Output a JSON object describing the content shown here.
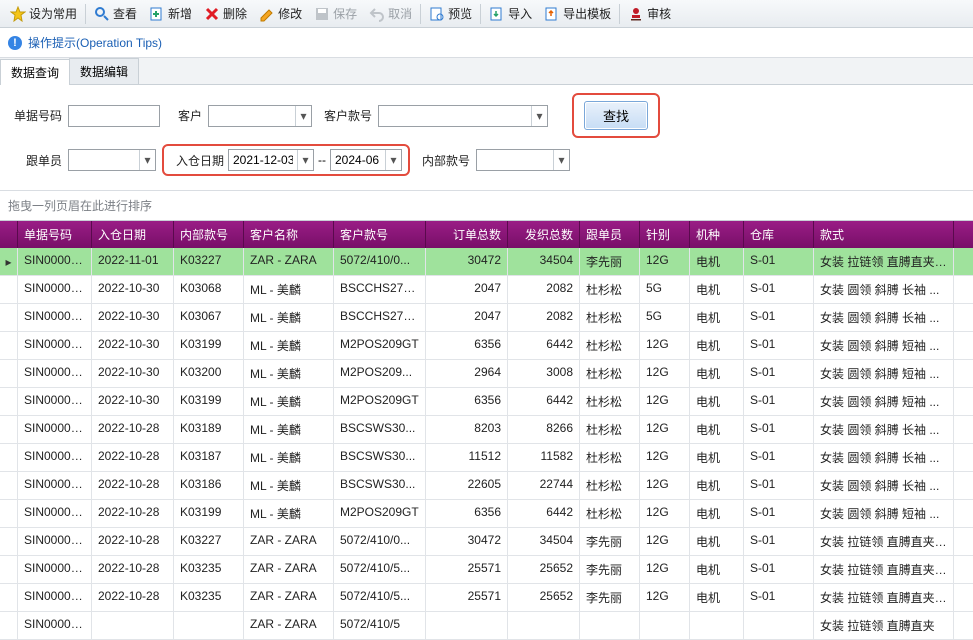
{
  "toolbar": {
    "fav": "设为常用",
    "view": "查看",
    "add": "新增",
    "del": "删除",
    "edit": "修改",
    "save": "保存",
    "cancel": "取消",
    "preview": "预览",
    "import": "导入",
    "exporttpl": "导出模板",
    "audit": "审核"
  },
  "tips": {
    "label": "操作提示(Operation Tips)"
  },
  "tabs": {
    "query": "数据查询",
    "edit": "数据编辑"
  },
  "search": {
    "doc_no_label": "单据号码",
    "cust_label": "客户",
    "cust_style_label": "客户款号",
    "follower_label": "跟单员",
    "indate_label": "入仓日期",
    "date_from": "2021-12-03",
    "date_to": "2024-06",
    "sep": "--",
    "internal_style_label": "内部款号",
    "btn": "查找"
  },
  "grid": {
    "group_hint": "拖曳一列页眉在此进行排序",
    "columns": [
      "单据号码",
      "入仓日期",
      "内部款号",
      "客户名称",
      "客户款号",
      "订单总数",
      "发织总数",
      "跟单员",
      "针别",
      "机种",
      "仓库",
      "款式"
    ],
    "rows": [
      {
        "sel": true,
        "d": [
          "SIN00006...",
          "2022-11-01",
          "K03227",
          "ZAR - ZARA",
          "5072/410/0...",
          "30472",
          "34504",
          "李先丽",
          "12G",
          "电机",
          "S-01",
          "女装 拉链领 直膊直夹 ..."
        ]
      },
      {
        "d": [
          "SIN00006...",
          "2022-10-30",
          "K03068",
          "ML - 美麟",
          "BSCCHS275...",
          "2047",
          "2082",
          "杜杉松",
          "5G",
          "电机",
          "S-01",
          "女装 圆领 斜膊 长袖 ..."
        ]
      },
      {
        "d": [
          "SIN00006...",
          "2022-10-30",
          "K03067",
          "ML - 美麟",
          "BSCCHS275...",
          "2047",
          "2082",
          "杜杉松",
          "5G",
          "电机",
          "S-01",
          "女装 圆领 斜膊 长袖 ..."
        ]
      },
      {
        "d": [
          "SIN00006...",
          "2022-10-30",
          "K03199",
          "ML - 美麟",
          "M2POS209GT",
          "6356",
          "6442",
          "杜杉松",
          "12G",
          "电机",
          "S-01",
          "女装 圆领 斜膊 短袖 ..."
        ]
      },
      {
        "d": [
          "SIN00006...",
          "2022-10-30",
          "K03200",
          "ML - 美麟",
          "M2POS209...",
          "2964",
          "3008",
          "杜杉松",
          "12G",
          "电机",
          "S-01",
          "女装 圆领 斜膊 短袖 ..."
        ]
      },
      {
        "d": [
          "SIN00006...",
          "2022-10-30",
          "K03199",
          "ML - 美麟",
          "M2POS209GT",
          "6356",
          "6442",
          "杜杉松",
          "12G",
          "电机",
          "S-01",
          "女装 圆领 斜膊 短袖 ..."
        ]
      },
      {
        "d": [
          "SIN00006...",
          "2022-10-28",
          "K03189",
          "ML - 美麟",
          "BSCSWS30...",
          "8203",
          "8266",
          "杜杉松",
          "12G",
          "电机",
          "S-01",
          "女装 圆领 斜膊 长袖 ..."
        ]
      },
      {
        "d": [
          "SIN00006...",
          "2022-10-28",
          "K03187",
          "ML - 美麟",
          "BSCSWS30...",
          "11512",
          "11582",
          "杜杉松",
          "12G",
          "电机",
          "S-01",
          "女装 圆领 斜膊 长袖 ..."
        ]
      },
      {
        "d": [
          "SIN00006...",
          "2022-10-28",
          "K03186",
          "ML - 美麟",
          "BSCSWS30...",
          "22605",
          "22744",
          "杜杉松",
          "12G",
          "电机",
          "S-01",
          "女装 圆领 斜膊 长袖 ..."
        ]
      },
      {
        "d": [
          "SIN00006...",
          "2022-10-28",
          "K03199",
          "ML - 美麟",
          "M2POS209GT",
          "6356",
          "6442",
          "杜杉松",
          "12G",
          "电机",
          "S-01",
          "女装 圆领 斜膊 短袖 ..."
        ]
      },
      {
        "d": [
          "SIN00006...",
          "2022-10-28",
          "K03227",
          "ZAR - ZARA",
          "5072/410/0...",
          "30472",
          "34504",
          "李先丽",
          "12G",
          "电机",
          "S-01",
          "女装 拉链领 直膊直夹 ..."
        ]
      },
      {
        "d": [
          "SIN00006...",
          "2022-10-28",
          "K03235",
          "ZAR - ZARA",
          "5072/410/5...",
          "25571",
          "25652",
          "李先丽",
          "12G",
          "电机",
          "S-01",
          "女装 拉链领 直膊直夹 ..."
        ]
      },
      {
        "d": [
          "SIN00006...",
          "2022-10-28",
          "K03235",
          "ZAR - ZARA",
          "5072/410/5...",
          "25571",
          "25652",
          "李先丽",
          "12G",
          "电机",
          "S-01",
          "女装 拉链领 直膊直夹 ..."
        ]
      },
      {
        "d": [
          "SIN00006...",
          "",
          "",
          "ZAR - ZARA",
          "5072/410/5",
          "",
          "",
          "",
          "",
          "",
          "",
          "女装 拉链领 直膊直夹"
        ]
      }
    ]
  }
}
